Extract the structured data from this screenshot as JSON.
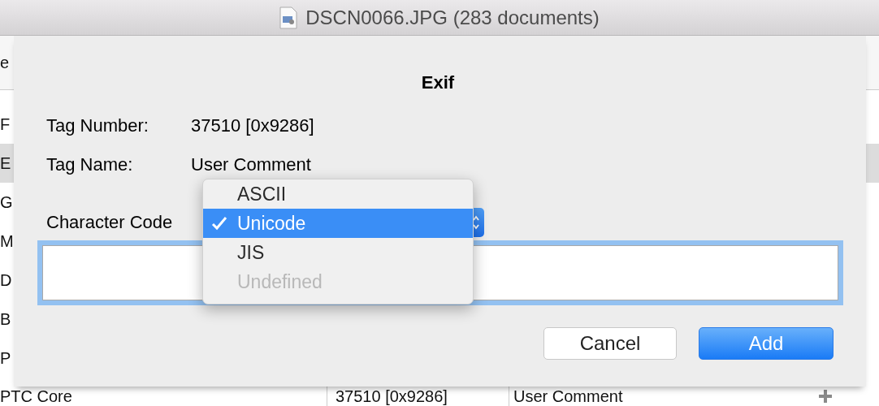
{
  "window": {
    "title": "DSCN0066.JPG (283 documents)"
  },
  "background_table": {
    "header": {
      "column_1": "e"
    },
    "rows": [
      {
        "column_1": "F",
        "selected": false
      },
      {
        "column_1": "E",
        "selected": true
      },
      {
        "column_1": "G",
        "selected": false
      },
      {
        "column_1": "M",
        "selected": false
      },
      {
        "column_1": "D",
        "selected": false
      },
      {
        "column_1": "B",
        "selected": false
      },
      {
        "column_1": "P",
        "selected": false
      },
      {
        "column_1": "PTC Core",
        "column_2": "37510 [0x9286]",
        "column_3": "User Comment",
        "selected": false
      }
    ]
  },
  "sheet": {
    "title": "Exif",
    "fields": [
      {
        "label": "Tag Number:",
        "value": "37510 [0x9286]"
      },
      {
        "label": "Tag Name:",
        "value": "User Comment"
      }
    ],
    "character_code": {
      "label": "Character Code",
      "menu": [
        {
          "label": "ASCII",
          "checked": false,
          "selected": false,
          "disabled": false
        },
        {
          "label": "Unicode",
          "checked": true,
          "selected": true,
          "disabled": false
        },
        {
          "label": "JIS",
          "checked": false,
          "selected": false,
          "disabled": false
        },
        {
          "label": "Undefined",
          "checked": false,
          "selected": false,
          "disabled": true
        }
      ]
    },
    "comment_field": {
      "focused": true
    },
    "buttons": [
      {
        "label": "Cancel",
        "kind": "secondary"
      },
      {
        "label": "Add",
        "kind": "primary"
      }
    ]
  }
}
